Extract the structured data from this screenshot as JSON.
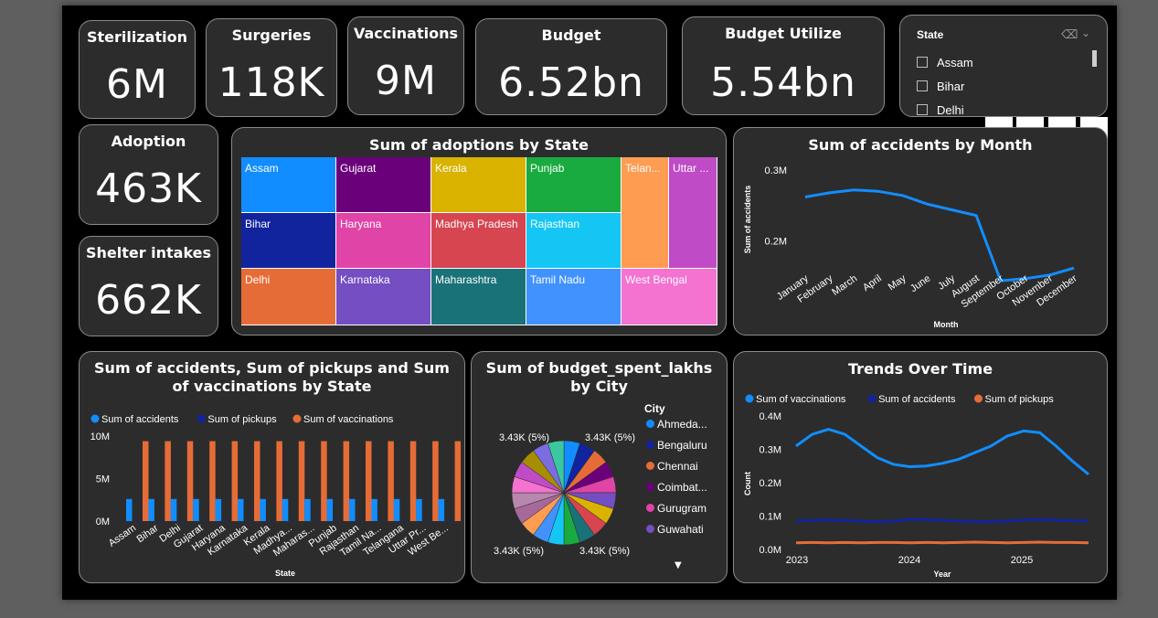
{
  "kpis": [
    {
      "label": "Sterilization",
      "value": "6M"
    },
    {
      "label": "Surgeries",
      "value": "118K"
    },
    {
      "label": "Vaccinations",
      "value": "9M"
    },
    {
      "label": "Budget",
      "value": "6.52bn"
    },
    {
      "label": "Budget Utilize",
      "value": "5.54bn"
    },
    {
      "label": "Adoption",
      "value": "463K"
    },
    {
      "label": "Shelter intakes",
      "value": "662K"
    }
  ],
  "slicer": {
    "title": "State",
    "items": [
      "Assam",
      "Bihar",
      "Delhi"
    ]
  },
  "treemap": {
    "title": "Sum of adoptions by State",
    "tiles": [
      {
        "label": "Assam",
        "color": "#118dff"
      },
      {
        "label": "Gujarat",
        "color": "#6b007b"
      },
      {
        "label": "Kerala",
        "color": "#d9b300"
      },
      {
        "label": "Punjab",
        "color": "#1aab40"
      },
      {
        "label": "Telan...",
        "color": "#fe9c52"
      },
      {
        "label": "Uttar ...",
        "color": "#c04bc6"
      },
      {
        "label": "Bihar",
        "color": "#12239e"
      },
      {
        "label": "Haryana",
        "color": "#e044a7"
      },
      {
        "label": "Madhya Pradesh",
        "color": "#d64550"
      },
      {
        "label": "Rajasthan",
        "color": "#15c6f4"
      },
      {
        "label": "Delhi",
        "color": "#e66c37"
      },
      {
        "label": "Karnataka",
        "color": "#744ec2"
      },
      {
        "label": "Maharashtra",
        "color": "#197278"
      },
      {
        "label": "Tamil Nadu",
        "color": "#4092ff"
      },
      {
        "label": "West Bengal",
        "color": "#f472d0"
      }
    ]
  },
  "accidents_month": {
    "title_text": "Sum of accidents by Month",
    "chart_data": {
      "type": "line",
      "x": [
        "January",
        "February",
        "March",
        "April",
        "May",
        "June",
        "July",
        "August",
        "September",
        "October",
        "November",
        "December"
      ],
      "series": [
        {
          "values": [
            0.262,
            0.268,
            0.272,
            0.27,
            0.264,
            0.252,
            0.244,
            0.236,
            0.144,
            0.147,
            0.152,
            0.162
          ]
        }
      ],
      "ylabel": "Sum of accidents",
      "xlabel": "Month",
      "yticks": [
        "0.3M",
        "0.2M"
      ],
      "ylim": [
        0.13,
        0.3
      ],
      "color": "#118dff"
    }
  },
  "state_bars": {
    "title_text": "Sum of accidents, Sum of pickups and Sum of vaccinations by State",
    "chart_data": {
      "type": "bar",
      "categories": [
        "Assam",
        "Bihar",
        "Delhi",
        "Gujarat",
        "Haryana",
        "Karnataka",
        "Kerala",
        "Madhya...",
        "Maharas...",
        "Punjab",
        "Rajasthan",
        "Tamil Na...",
        "Telangana",
        "Uttar Pr...",
        "West Be..."
      ],
      "series": [
        {
          "name": "Sum of accidents",
          "color": "#118dff",
          "values": [
            2.6,
            2.6,
            2.6,
            2.6,
            2.6,
            2.6,
            2.6,
            2.6,
            2.6,
            2.6,
            2.6,
            2.6,
            2.6,
            2.6,
            2.6
          ]
        },
        {
          "name": "Sum of pickups",
          "color": "#12239e",
          "values": [
            0.05,
            0.05,
            0.05,
            0.05,
            0.05,
            0.05,
            0.05,
            0.05,
            0.05,
            0.05,
            0.05,
            0.05,
            0.05,
            0.05,
            0.05
          ]
        },
        {
          "name": "Sum of vaccinations",
          "color": "#e66c37",
          "values": [
            9.4,
            9.4,
            9.4,
            9.4,
            9.4,
            9.4,
            9.4,
            9.4,
            9.4,
            9.4,
            9.4,
            9.4,
            9.4,
            9.4,
            9.4
          ]
        }
      ],
      "yticks": [
        "10M",
        "5M",
        "0M"
      ],
      "ylim": [
        0,
        10
      ],
      "xlabel": "State"
    }
  },
  "city_pie": {
    "title_text": "Sum of budget_spent_lakhs by City",
    "legend_title": "City",
    "chart_data": {
      "type": "pie",
      "slice_count": 20,
      "slice_value": "3.43K (5%)",
      "labels": [
        "3.43K (5%)",
        "3.43K (5%)",
        "3.43K (5%)",
        "3.43K (5%)"
      ],
      "legend": [
        {
          "name": "Ahmeda...",
          "color": "#118dff"
        },
        {
          "name": "Bengaluru",
          "color": "#12239e"
        },
        {
          "name": "Chennai",
          "color": "#e66c37"
        },
        {
          "name": "Coimbat...",
          "color": "#6b007b"
        },
        {
          "name": "Gurugram",
          "color": "#e044a7"
        },
        {
          "name": "Guwahati",
          "color": "#744ec2"
        }
      ],
      "colors": [
        "#118dff",
        "#12239e",
        "#e66c37",
        "#6b007b",
        "#e044a7",
        "#744ec2",
        "#d9b300",
        "#d64550",
        "#197278",
        "#1aab40",
        "#15c6f4",
        "#4092ff",
        "#fe9c52",
        "#a66999",
        "#b887ad",
        "#f472d0",
        "#c04bc6",
        "#a68e00",
        "#7b6ce0",
        "#3bc8a0"
      ]
    }
  },
  "trends": {
    "title_text": "Trends Over Time",
    "chart_data": {
      "type": "line",
      "x_ticks": [
        "2023",
        "2024",
        "2025"
      ],
      "ylabel": "Count",
      "xlabel": "Year",
      "yticks": [
        "0.4M",
        "0.3M",
        "0.2M",
        "0.1M",
        "0.0M"
      ],
      "ylim": [
        0,
        0.4
      ],
      "series": [
        {
          "name": "Sum of vaccinations",
          "color": "#118dff",
          "values": [
            0.31,
            0.345,
            0.36,
            0.345,
            0.31,
            0.275,
            0.255,
            0.248,
            0.25,
            0.258,
            0.27,
            0.29,
            0.31,
            0.34,
            0.355,
            0.35,
            0.31,
            0.265,
            0.225
          ]
        },
        {
          "name": "Sum of accidents",
          "color": "#12239e",
          "values": [
            0.085,
            0.087,
            0.088,
            0.087,
            0.085,
            0.083,
            0.085,
            0.09,
            0.09,
            0.088,
            0.085,
            0.084,
            0.083,
            0.085,
            0.088,
            0.09,
            0.088,
            0.086,
            0.085
          ]
        },
        {
          "name": "Sum of pickups",
          "color": "#e66c37",
          "values": [
            0.02,
            0.021,
            0.02,
            0.021,
            0.02,
            0.021,
            0.021,
            0.02,
            0.021,
            0.02,
            0.021,
            0.022,
            0.021,
            0.02,
            0.021,
            0.022,
            0.021,
            0.021,
            0.02
          ]
        }
      ]
    }
  }
}
